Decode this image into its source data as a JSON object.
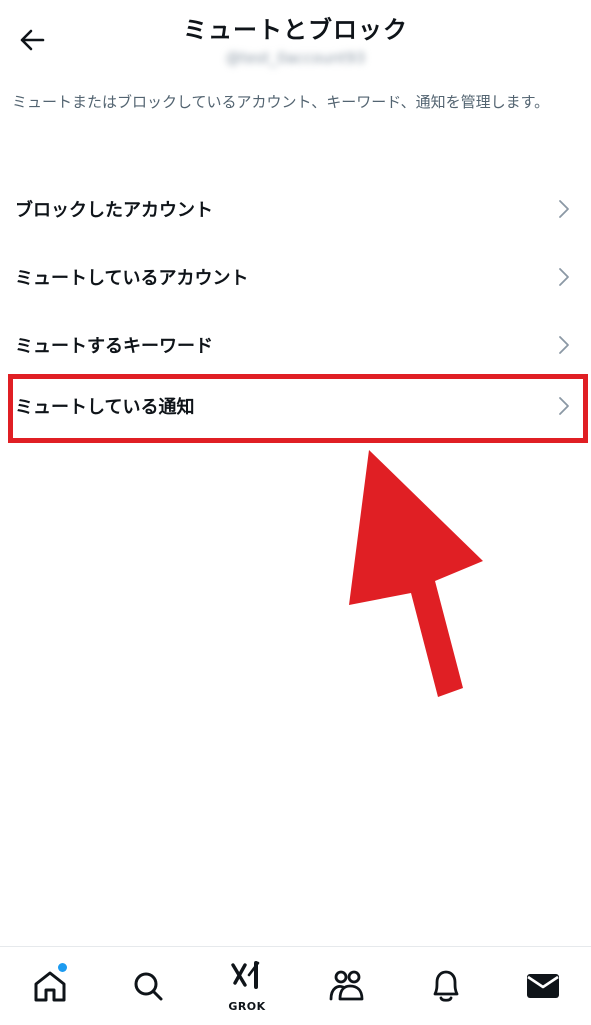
{
  "header": {
    "title": "ミュートとブロック",
    "handle": "@test_0account93"
  },
  "description": "ミュートまたはブロックしているアカウント、キーワード、通知を管理します。",
  "menu": {
    "items": [
      {
        "label": "ブロックしたアカウント"
      },
      {
        "label": "ミュートしているアカウント"
      },
      {
        "label": "ミュートするキーワード"
      },
      {
        "label": "ミュートしている通知"
      }
    ]
  },
  "bottom_nav": {
    "grok_label": "GROK",
    "icons": [
      "home-icon",
      "search-icon",
      "grok-icon",
      "communities-icon",
      "bell-icon",
      "mail-icon"
    ]
  },
  "colors": {
    "highlight": "#e01f24",
    "accent": "#1d9bf0",
    "text": "#0f1419",
    "muted": "#536471"
  }
}
